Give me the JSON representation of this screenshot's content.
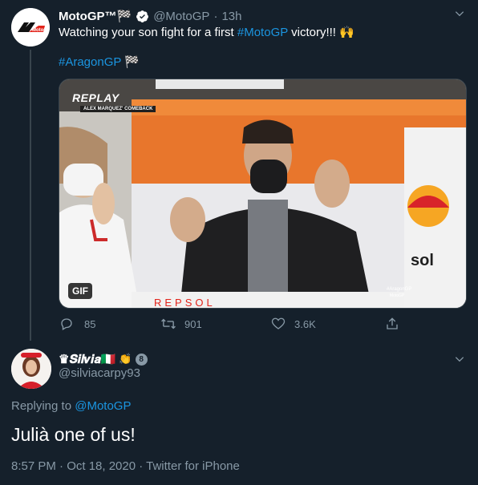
{
  "parent_tweet": {
    "display_name": "MotoGP™",
    "name_flag": "🏁",
    "handle": "@MotoGP",
    "separator": "·",
    "time": "13h",
    "text_prefix": "Watching your son fight for a first ",
    "text_hashtag": "#MotoGP",
    "text_suffix": " victory!!! 🙌",
    "hashtag_line": "#AragonGP",
    "hashtag_flag": "🏁",
    "media": {
      "badge": "GIF",
      "replay_label": "REPLAY",
      "replay_caption": "ALEX MARQUEZ' COMEBACK",
      "corner_caption_1": "#AragonGP",
      "corner_caption_2": "MotoGP",
      "sponsor_text": "REPSOL",
      "side_text": "sol"
    },
    "actions": {
      "replies": "85",
      "retweets": "901",
      "likes": "3.6K"
    }
  },
  "reply_tweet": {
    "display_name": "♛𝑺𝒊𝒍𝒗𝒊𝒂🇮🇹",
    "badge_number": "8",
    "handle": "@silviacarpy93",
    "replying_prefix": "Replying to ",
    "replying_to": "@MotoGP",
    "text": "Julià one of us!",
    "timestamp": "8:57 PM · Oct 18, 2020 · Twitter for iPhone"
  },
  "colors": {
    "background": "#15202b",
    "link": "#1b95e0",
    "muted": "#8899a6",
    "border": "#38444d",
    "motogp_red": "#e2231a"
  }
}
